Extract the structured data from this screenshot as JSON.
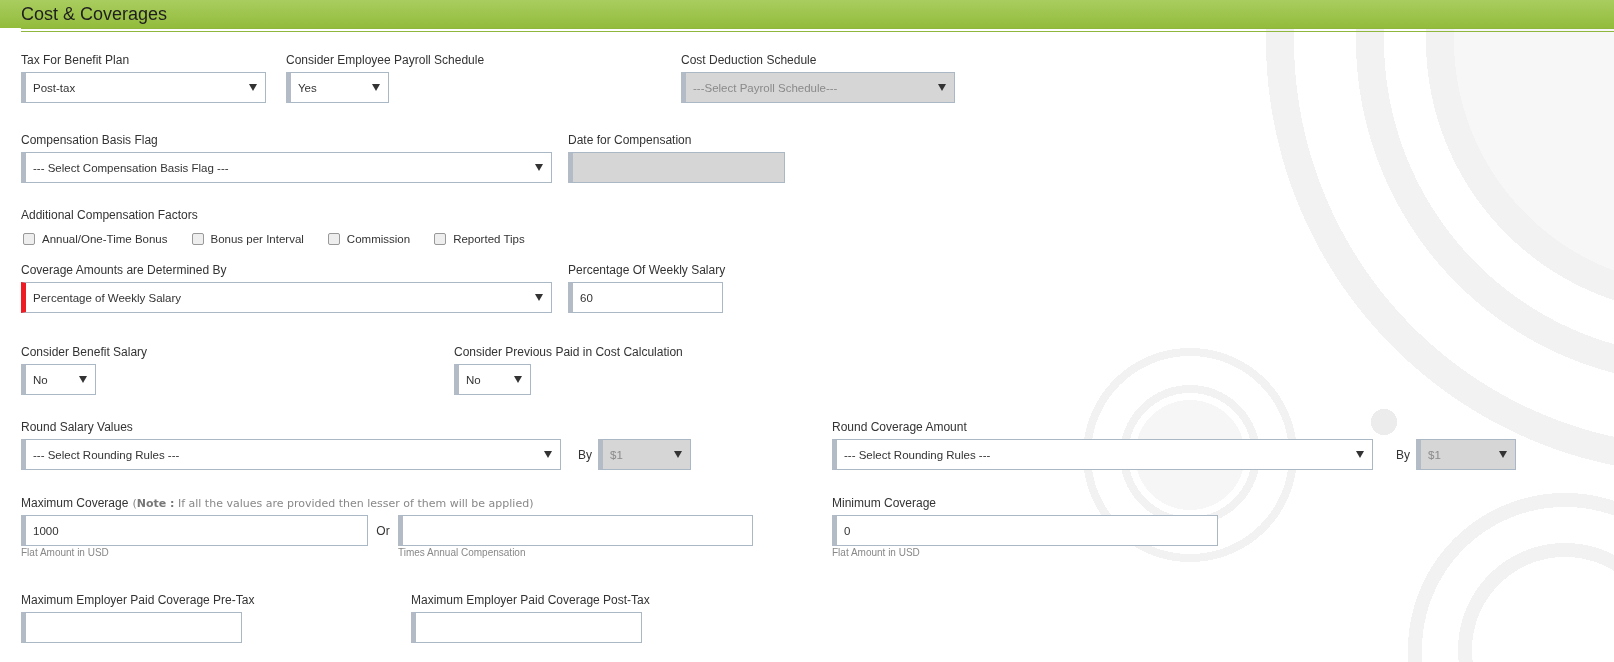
{
  "section": {
    "title": "Cost & Coverages"
  },
  "rows": [
    {
      "fields": [
        {
          "kind": "select",
          "label": "Tax For Benefit Plan",
          "value": "Post-tax",
          "disabled": false,
          "error": false
        },
        {
          "kind": "select",
          "label": "Consider Employee Payroll Schedule",
          "value": "Yes",
          "disabled": false,
          "error": false
        },
        {
          "kind": "select",
          "label": "Cost Deduction Schedule",
          "value": "---Select Payroll Schedule---",
          "disabled": true,
          "error": false
        }
      ]
    },
    {
      "fields": [
        {
          "kind": "select",
          "label": "Compensation Basis Flag",
          "value": "--- Select Compensation Basis Flag ---",
          "disabled": false,
          "error": false
        },
        {
          "kind": "input",
          "label": "Date for Compensation",
          "disabled": true,
          "error": false
        }
      ]
    },
    {
      "fields": [
        {
          "kind": "checkboxes",
          "label": "Additional Compensation Factors",
          "options": [
            {
              "label": "Annual/One-Time Bonus",
              "checked": false
            },
            {
              "label": "Bonus per Interval",
              "checked": false
            },
            {
              "label": "Commission",
              "checked": false
            },
            {
              "label": "Reported Tips",
              "checked": false
            }
          ]
        }
      ]
    },
    {
      "fields": [
        {
          "kind": "select",
          "label": "Coverage Amounts are Determined By",
          "value": "Percentage of Weekly Salary",
          "disabled": false,
          "error": true
        },
        {
          "kind": "input",
          "label": "Percentage Of Weekly Salary",
          "value": "60",
          "disabled": false,
          "error": false
        }
      ]
    },
    {
      "fields": [
        {
          "kind": "select",
          "label": "Consider Benefit Salary",
          "value": "No",
          "disabled": false,
          "error": false
        },
        {
          "kind": "select",
          "label": "Consider Previous Paid in Cost Calculation",
          "value": "No",
          "disabled": false,
          "error": false
        }
      ]
    },
    {
      "fields": [
        {
          "kind": "select",
          "label": "Round Salary Values",
          "value": "--- Select Rounding Rules ---",
          "disabled": false,
          "error": false
        },
        {
          "kind": "joiner",
          "text": "By"
        },
        {
          "kind": "select",
          "value": "$1",
          "disabled": true,
          "error": false
        },
        {
          "kind": "select",
          "label": "Round Coverage Amount",
          "value": "--- Select Rounding Rules ---",
          "disabled": false,
          "error": false
        },
        {
          "kind": "joiner",
          "text": "By"
        },
        {
          "kind": "select",
          "value": "$1",
          "disabled": true,
          "error": false
        }
      ]
    },
    {
      "fields": [
        {
          "kind": "input",
          "label": "Maximum Coverage",
          "note": "(**Note :** If all the values are provided then lesser of them will be applied)",
          "value": "1000",
          "hint": "Flat Amount in USD",
          "disabled": false,
          "error": false
        },
        {
          "kind": "joiner",
          "text": "Or"
        },
        {
          "kind": "input",
          "hint": "Times Annual Compensation",
          "disabled": false,
          "error": false
        },
        {
          "kind": "input",
          "label": "Minimum Coverage",
          "value": "0",
          "hint": "Flat Amount in USD",
          "disabled": false,
          "error": false
        }
      ]
    },
    {
      "fields": [
        {
          "kind": "input",
          "label": "Maximum Employer Paid Coverage Pre-Tax",
          "disabled": false,
          "error": false
        },
        {
          "kind": "input",
          "label": "Maximum Employer Paid Coverage Post-Tax",
          "disabled": false,
          "error": false
        }
      ]
    }
  ]
}
